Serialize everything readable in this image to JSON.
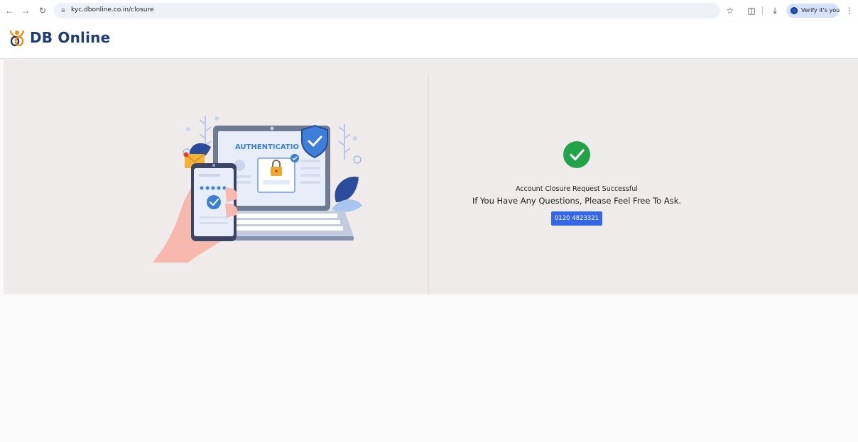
{
  "browser": {
    "url": "kyc.dbonline.co.in/closure",
    "profile_label": "Verify it's you",
    "icons": [
      "back-icon",
      "forward-icon",
      "reload-icon",
      "site-info-icon",
      "star-icon",
      "extensions-icon",
      "download-icon",
      "profile-icon",
      "more-icon"
    ]
  },
  "site": {
    "brand": "DB Online",
    "brand_color": "#1e3b73",
    "logo_color": "#f08c1e"
  },
  "illustration": {
    "screen_heading": "AUTHENTICATIO"
  },
  "result": {
    "status": "success",
    "status_color": "#22a34a",
    "title": "Account Closure Request Successful",
    "message": "If You Have Any Questions, Please Feel Free To Ask.",
    "phone": "0120 4823321",
    "button_color": "#3566e6"
  }
}
